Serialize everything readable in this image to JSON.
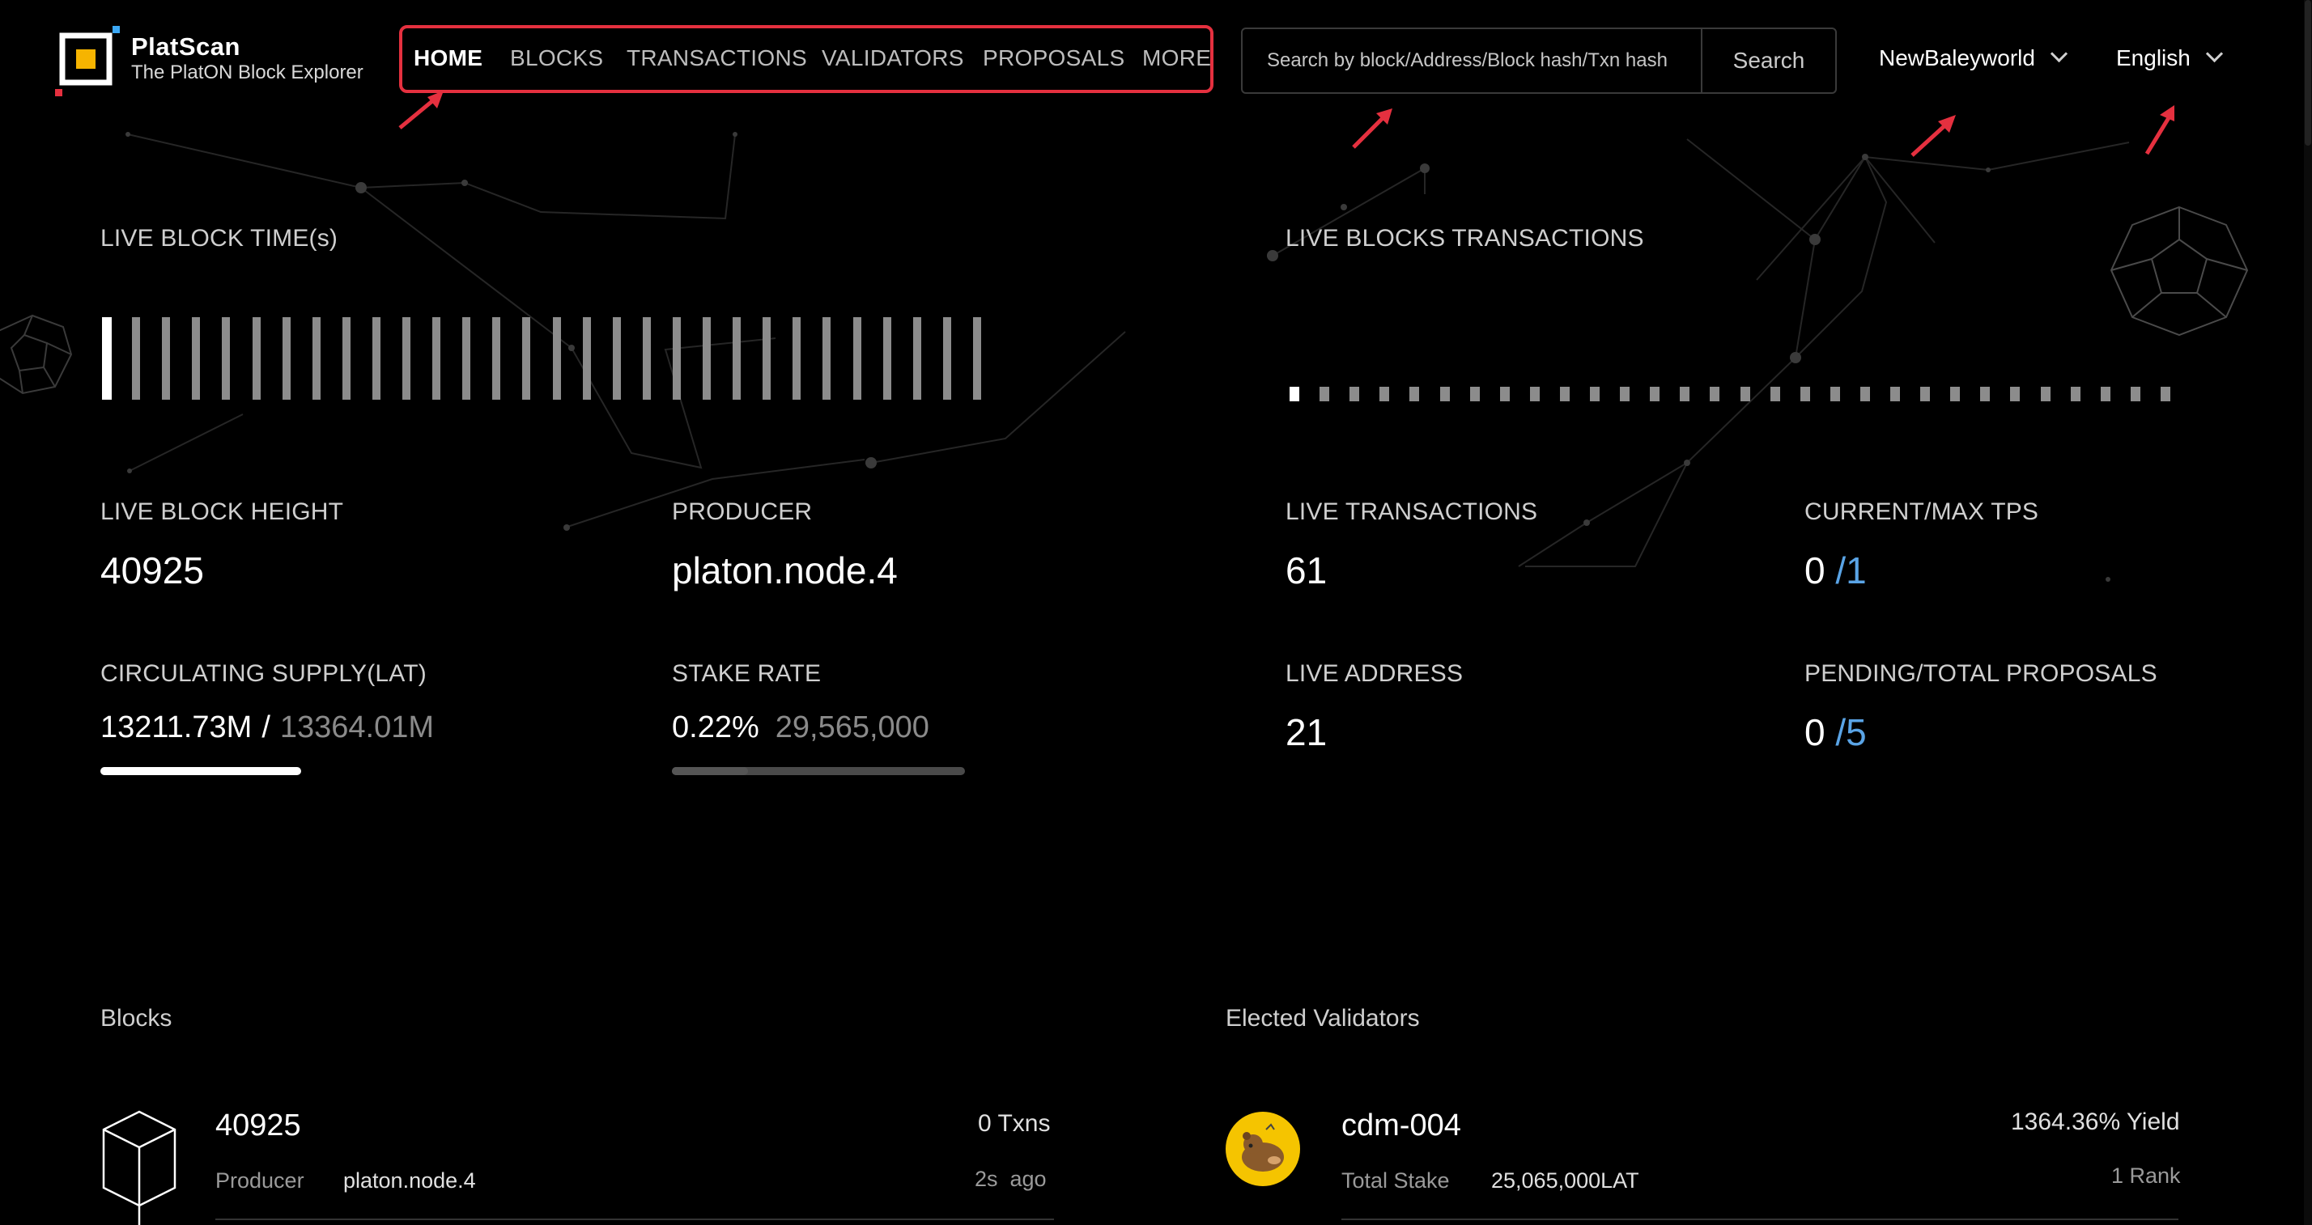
{
  "brand": {
    "name": "PlatScan",
    "tagline": "The PlatON Block Explorer"
  },
  "nav": {
    "items": [
      {
        "label": "HOME",
        "active": true
      },
      {
        "label": "BLOCKS",
        "active": false
      },
      {
        "label": "TRANSACTIONS",
        "active": false
      },
      {
        "label": "VALIDATORS",
        "active": false
      },
      {
        "label": "PROPOSALS",
        "active": false
      },
      {
        "label": "MORE",
        "active": false
      }
    ],
    "highlight_color": "#e5303f"
  },
  "search": {
    "placeholder": "Search by block/Address/Block hash/Txn hash",
    "value": "",
    "button_label": "Search"
  },
  "network_selector": {
    "label": "NewBaleyworld",
    "icon": "chevron-down-icon"
  },
  "language_selector": {
    "label": "English",
    "icon": "chevron-down-icon"
  },
  "stats": {
    "live_block_time": {
      "title": "LIVE BLOCK TIME(s)"
    },
    "live_blocks_transactions": {
      "title": "LIVE BLOCKS TRANSACTIONS"
    },
    "live_block_height": {
      "title": "LIVE BLOCK HEIGHT",
      "value": "40925"
    },
    "producer": {
      "title": "PRODUCER",
      "value": "platon.node.4"
    },
    "circulating_supply": {
      "title": "CIRCULATING SUPPLY(LAT)",
      "value": "13211.73M",
      "separator": "/",
      "total": "13364.01M",
      "progress": 0.52
    },
    "stake_rate": {
      "title": "STAKE RATE",
      "value": "0.22%",
      "amount": "29,565,000",
      "progress": 0.26
    },
    "live_transactions": {
      "title": "LIVE TRANSACTIONS",
      "value": "61"
    },
    "current_max_tps": {
      "title": "CURRENT/MAX TPS",
      "current": "0",
      "max": "/1"
    },
    "live_address": {
      "title": "LIVE ADDRESS",
      "value": "21"
    },
    "pending_total_proposals": {
      "title": "PENDING/TOTAL PROPOSALS",
      "pending": "0",
      "total": "/5"
    }
  },
  "blocks": {
    "title": "Blocks",
    "items": [
      {
        "height": "40925",
        "txns": "0 Txns",
        "producer_label": "Producer",
        "producer": "platon.node.4",
        "age": "2s  ago"
      }
    ]
  },
  "validators": {
    "title": "Elected Validators",
    "items": [
      {
        "name": "cdm-004",
        "yield": "1364.36% Yield",
        "stake_label": "Total Stake",
        "stake": "25,065,000LAT",
        "rank": "1 Rank"
      }
    ]
  },
  "colors": {
    "accent_blue": "#5aa4e6",
    "background": "#000000",
    "annotation_red": "#e5303f"
  }
}
